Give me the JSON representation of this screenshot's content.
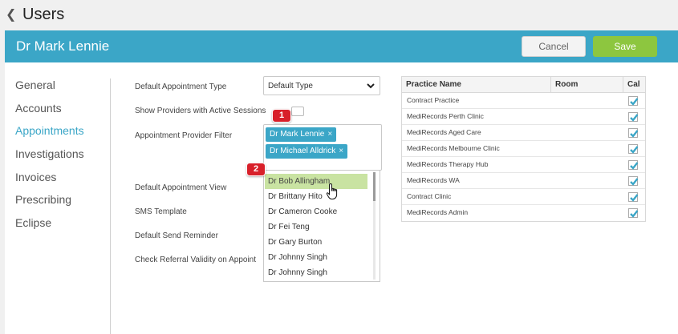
{
  "page": {
    "title": "Users"
  },
  "header": {
    "provider_name": "Dr Mark Lennie",
    "cancel_label": "Cancel",
    "save_label": "Save"
  },
  "sidebar": {
    "items": [
      {
        "label": "General"
      },
      {
        "label": "Accounts"
      },
      {
        "label": "Appointments",
        "active": true
      },
      {
        "label": "Investigations"
      },
      {
        "label": "Invoices"
      },
      {
        "label": "Prescribing"
      },
      {
        "label": "Eclipse"
      }
    ]
  },
  "form": {
    "default_appointment_type": {
      "label": "Default Appointment Type",
      "value": "Default Type"
    },
    "show_active_sessions": {
      "label": "Show Providers with Active Sessions",
      "checked": false
    },
    "provider_filter": {
      "label": "Appointment Provider Filter",
      "selected": [
        "Dr Mark Lennie",
        "Dr Michael Alldrick"
      ],
      "options": [
        "Dr Bob Allingham",
        "Dr Brittany Hito",
        "Dr Cameron Cooke",
        "Dr Fei Teng",
        "Dr Gary Burton",
        "Dr Johnny Singh",
        "Dr Johnny Singh"
      ],
      "highlighted": "Dr Bob Allingham"
    },
    "default_appointment_view": {
      "label": "Default Appointment View"
    },
    "sms_template": {
      "label": "SMS Template"
    },
    "default_send_reminder": {
      "label": "Default Send Reminder"
    },
    "check_referral_validity": {
      "label": "Check Referral Validity on Appoint"
    }
  },
  "callouts": {
    "one": "1",
    "two": "2"
  },
  "practice_table": {
    "headers": {
      "name": "Practice Name",
      "room": "Room",
      "cal": "Cal"
    },
    "rows": [
      {
        "name": "Contract Practice",
        "cal": true
      },
      {
        "name": "MediRecords Perth Clinic",
        "cal": true
      },
      {
        "name": "MediRecords Aged Care",
        "cal": true
      },
      {
        "name": "MediRecords Melbourne Clinic",
        "cal": true
      },
      {
        "name": "MediRecords Therapy Hub",
        "cal": true
      },
      {
        "name": "MediRecords WA",
        "cal": true
      },
      {
        "name": "Contract Clinic",
        "cal": true
      },
      {
        "name": "MediRecords Admin",
        "cal": true
      }
    ]
  },
  "colors": {
    "accent": "#3ba6c7",
    "save": "#8dc63f",
    "callout": "#d8202a",
    "check": "#3ba6c7"
  }
}
